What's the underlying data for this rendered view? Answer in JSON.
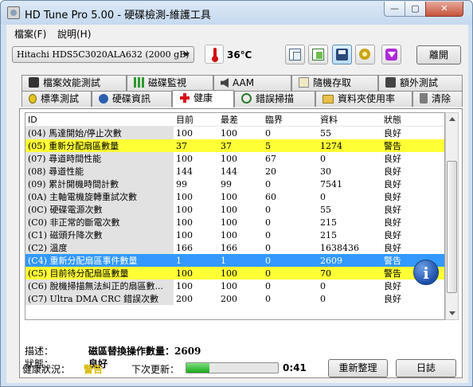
{
  "window": {
    "title": "HD Tune Pro  5.00 - 硬碟檢測-維護工具",
    "minimize": "—",
    "maximize": "▢",
    "close": "✕"
  },
  "menu": {
    "file": "檔案(F)",
    "help": "說明(H)"
  },
  "toolbar": {
    "drive": "Hitachi HDS5C3020ALA632 (2000 gB)",
    "temperature": "36℃",
    "exit_label": "離開"
  },
  "tabs_top": [
    {
      "label": "檔案效能測試",
      "icon": "monitor-icon"
    },
    {
      "label": "磁碟監視",
      "icon": "bars-icon"
    },
    {
      "label": "AAM",
      "icon": "speaker-icon"
    },
    {
      "label": "隨機存取",
      "icon": "random-icon"
    },
    {
      "label": "額外測試",
      "icon": "extra-icon"
    }
  ],
  "tabs_bottom": [
    {
      "label": "標準測試",
      "icon": "bulb-icon"
    },
    {
      "label": "硬碟資訊",
      "icon": "info-icon"
    },
    {
      "label": "健康",
      "icon": "red-cross-icon",
      "active": true
    },
    {
      "label": "錯誤掃描",
      "icon": "scan-icon"
    },
    {
      "label": "資料夾使用率",
      "icon": "folder-icon"
    },
    {
      "label": "清除",
      "icon": "trash-icon"
    }
  ],
  "table": {
    "headers": [
      "ID",
      "目前",
      "最差",
      "臨界",
      "資料",
      "狀態"
    ],
    "rows": [
      {
        "id": "(04) 馬達開始/停止次數",
        "cur": "100",
        "worst": "100",
        "thr": "0",
        "data": "55",
        "status": "良好",
        "hl": ""
      },
      {
        "id": "(05) 重新分配扇區數量",
        "cur": "37",
        "worst": "37",
        "thr": "5",
        "data": "1274",
        "status": "警告",
        "hl": "yellow"
      },
      {
        "id": "(07) 尋道時間性能",
        "cur": "100",
        "worst": "100",
        "thr": "67",
        "data": "0",
        "status": "良好",
        "hl": ""
      },
      {
        "id": "(08) 尋道性能",
        "cur": "144",
        "worst": "144",
        "thr": "20",
        "data": "30",
        "status": "良好",
        "hl": ""
      },
      {
        "id": "(09) 累計開機時間計數",
        "cur": "99",
        "worst": "99",
        "thr": "0",
        "data": "7541",
        "status": "良好",
        "hl": ""
      },
      {
        "id": "(0A) 主軸電機旋轉重試次數",
        "cur": "100",
        "worst": "100",
        "thr": "60",
        "data": "0",
        "status": "良好",
        "hl": ""
      },
      {
        "id": "(0C) 硬碟電源次數",
        "cur": "100",
        "worst": "100",
        "thr": "0",
        "data": "55",
        "status": "良好",
        "hl": ""
      },
      {
        "id": "(C0) 非正常的斷電次數",
        "cur": "100",
        "worst": "100",
        "thr": "0",
        "data": "215",
        "status": "良好",
        "hl": ""
      },
      {
        "id": "(C1) 磁頭升降次數",
        "cur": "100",
        "worst": "100",
        "thr": "0",
        "data": "215",
        "status": "良好",
        "hl": ""
      },
      {
        "id": "(C2) 溫度",
        "cur": "166",
        "worst": "166",
        "thr": "0",
        "data": "1638436",
        "status": "良好",
        "hl": ""
      },
      {
        "id": "(C4) 重新分配扇區事件數量",
        "cur": "1",
        "worst": "1",
        "thr": "0",
        "data": "2609",
        "status": "警告",
        "hl": "blue"
      },
      {
        "id": "(C5) 目前待分配扇區數量",
        "cur": "100",
        "worst": "100",
        "thr": "0",
        "data": "70",
        "status": "警告",
        "hl": "yellow"
      },
      {
        "id": "(C6) 脫機掃描無法糾正的扇區數...",
        "cur": "100",
        "worst": "100",
        "thr": "0",
        "data": "0",
        "status": "良好",
        "hl": ""
      },
      {
        "id": "(C7) Ultra DMA CRC 錯誤次數",
        "cur": "200",
        "worst": "200",
        "thr": "0",
        "data": "0",
        "status": "良好",
        "hl": ""
      }
    ]
  },
  "details": {
    "desc_label": "描述：",
    "desc_value": "磁區替換操作數量：2609",
    "state_label": "狀態：",
    "state_value": "良好"
  },
  "status": {
    "health_label": "健康狀況：",
    "health_value": "警告",
    "next_label": "下次更新：",
    "progress": 0.25,
    "countdown": "0:41",
    "refresh_label": "重新整理",
    "log_label": "日誌"
  },
  "colors": {
    "warning_row": "#ffff36",
    "selected_row": "#3399ff",
    "health_warning_text": "#d8b800"
  }
}
